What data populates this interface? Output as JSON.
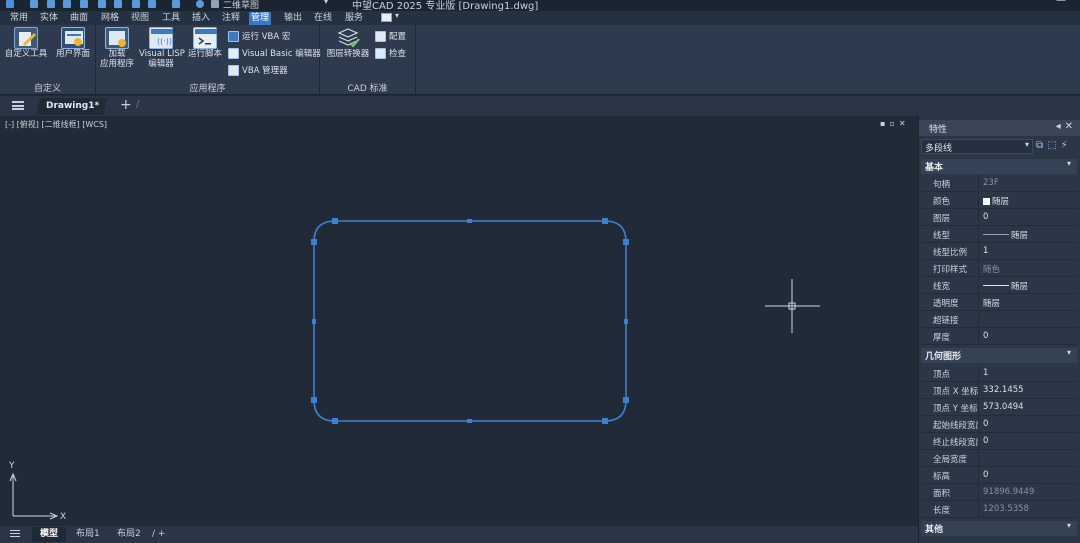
{
  "titlebar": {
    "workspace": "二维草图",
    "app_title": "中望CAD 2025 专业版  [Drawing1.dwg]",
    "minimize_symbol": "—"
  },
  "menu": {
    "tabs": [
      "常用",
      "实体",
      "曲面",
      "网格",
      "视图",
      "工具",
      "插入",
      "注释",
      "管理",
      "输出",
      "在线",
      "服务"
    ],
    "active": "管理"
  },
  "ribbon": {
    "panels": {
      "customize": {
        "title": "自定义",
        "buttons": [
          "自定义工具",
          "用户界面"
        ]
      },
      "apps": {
        "title": "应用程序",
        "load_app": [
          "加载",
          "应用程序"
        ],
        "lisp_editor": [
          "Visual LISP",
          "编辑器"
        ],
        "run_script": "运行脚本",
        "small": [
          "运行 VBA 宏",
          "Visual Basic 编辑器",
          "VBA 管理器"
        ]
      },
      "cad_standards": {
        "title": "CAD 标准",
        "layer_translator": "图层转换器",
        "small": [
          "配置",
          "检查"
        ]
      }
    }
  },
  "filetabs": {
    "active": "Drawing1*"
  },
  "viewport": {
    "label": "[-] [俯视] [二维线框] [WCS]",
    "axis_x": "X",
    "axis_y": "Y",
    "shape_color": "#3d7fd0"
  },
  "layout_tabs": [
    "模型",
    "布局1",
    "布局2"
  ],
  "properties": {
    "title": "特性",
    "selection": "多段线",
    "sections": {
      "basic": {
        "title": "基本",
        "rows": [
          {
            "k": "颜色",
            "v": "随层"
          },
          {
            "k": "图层",
            "v": "0"
          },
          {
            "k": "线型",
            "v": "随层"
          },
          {
            "k": "线型比例",
            "v": "1"
          },
          {
            "k": "打印样式",
            "v": "随色"
          },
          {
            "k": "线宽",
            "v": "随层"
          },
          {
            "k": "透明度",
            "v": "随层"
          },
          {
            "k": "超链接",
            "v": ""
          },
          {
            "k": "厚度",
            "v": "0"
          }
        ]
      },
      "geometry": {
        "title": "几何图形",
        "rows": [
          {
            "k": "顶点",
            "v": "1"
          },
          {
            "k": "顶点 X 坐标",
            "v": "332.1455"
          },
          {
            "k": "顶点 Y 坐标",
            "v": "573.0494"
          },
          {
            "k": "起始线段宽度",
            "v": "0"
          },
          {
            "k": "终止线段宽度",
            "v": "0"
          },
          {
            "k": "全局宽度",
            "v": ""
          },
          {
            "k": "标高",
            "v": "0"
          },
          {
            "k": "面积",
            "v": "91896.9449"
          },
          {
            "k": "长度",
            "v": "1203.5358"
          }
        ]
      },
      "other": {
        "title": "其他"
      }
    },
    "top_partial": {
      "k": "句柄",
      "v": "23F"
    }
  }
}
